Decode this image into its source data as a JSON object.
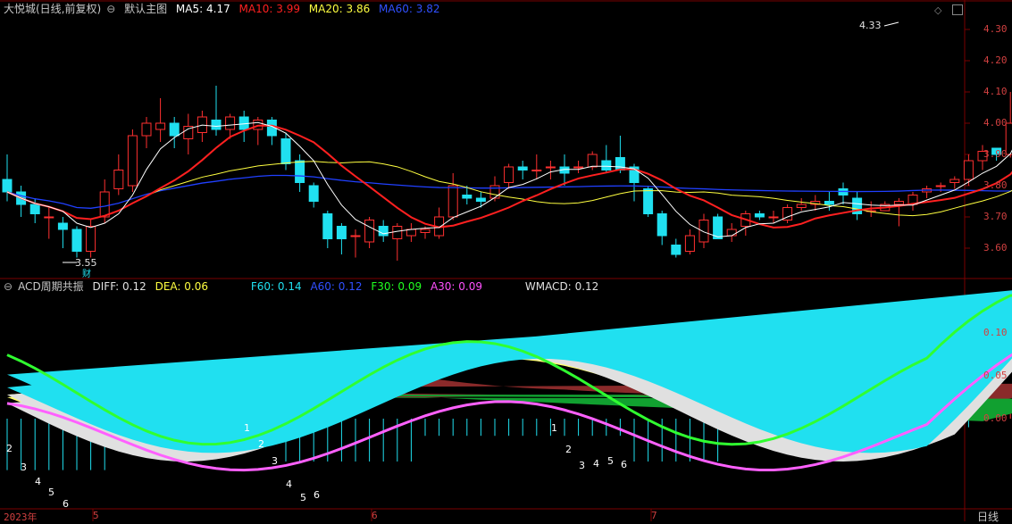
{
  "main_header": {
    "stock": "大悦城(日线,前复权)",
    "indicator": "默认主图",
    "ma5": {
      "label": "MA5:",
      "value": "4.17",
      "color": "#ffffff"
    },
    "ma10": {
      "label": "MA10:",
      "value": "3.99",
      "color": "#ff2020"
    },
    "ma20": {
      "label": "MA20:",
      "value": "3.86",
      "color": "#ffff40"
    },
    "ma60": {
      "label": "MA60:",
      "value": "3.82",
      "color": "#3050ff"
    }
  },
  "sub_header": {
    "indicator": "ACD周期共振",
    "diff": {
      "label": "DIFF:",
      "value": "0.12",
      "color": "#e0e0e0"
    },
    "dea": {
      "label": "DEA:",
      "value": "0.06",
      "color": "#ffff40"
    },
    "f60": {
      "label": "F60:",
      "value": "0.14",
      "color": "#20e0f0"
    },
    "a60": {
      "label": "A60:",
      "value": "0.12",
      "color": "#3050ff"
    },
    "f30": {
      "label": "F30:",
      "value": "0.09",
      "color": "#20ff20"
    },
    "a30": {
      "label": "A30:",
      "value": "0.09",
      "color": "#ff50ff"
    },
    "wmacd": {
      "label": "WMACD:",
      "value": "0.12",
      "color": "#e0e0e0"
    }
  },
  "price_axis": [
    "4.30",
    "4.20",
    "4.10",
    "4.00",
    "3.90",
    "3.80",
    "3.70",
    "3.60"
  ],
  "ind_axis": [
    "0.10",
    "0.05",
    "0.00"
  ],
  "date_axis": [
    "2023年",
    "5",
    "6",
    "7"
  ],
  "period_label": "日线",
  "annotations": {
    "high": "4.33",
    "low": "3.55",
    "finance": "财",
    "wave_nums_1": [
      "2",
      "3",
      "4",
      "5",
      "6"
    ],
    "wave_nums_2": [
      "1",
      "2",
      "3",
      "4",
      "5",
      "6"
    ],
    "wave_nums_3": [
      "1",
      "2",
      "3",
      "4",
      "5",
      "6"
    ]
  },
  "colors": {
    "up": "#ff3030",
    "down": "#20e0f0",
    "grid": "#7a0000"
  }
}
